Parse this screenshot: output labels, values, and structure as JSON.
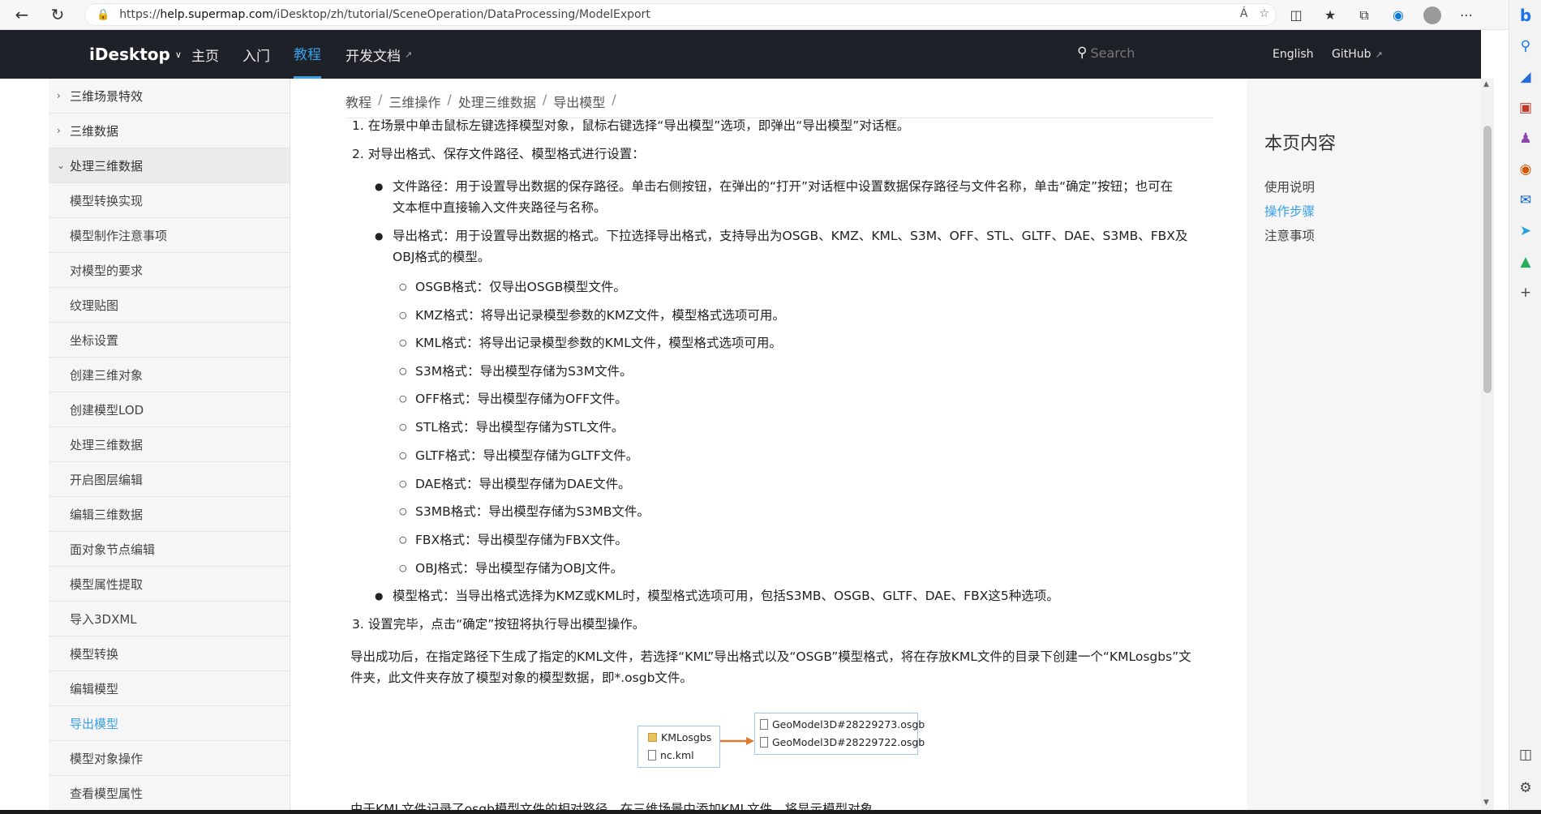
{
  "browser": {
    "url_prefix": "https://",
    "url_host": "help.supermap.com",
    "url_path": "/iDesktop/zh/tutorial/SceneOperation/DataProcessing/ModelExport",
    "read_aloud": "Á",
    "icons": [
      "back-icon",
      "refresh-icon",
      "lock-icon",
      "read-aloud-icon",
      "favorite-add-icon",
      "split-screen-icon",
      "favorites-icon",
      "collections-icon",
      "browser-essentials-icon",
      "profile-avatar",
      "more-icon"
    ]
  },
  "edge_sidebar": {
    "icons": [
      "bing-copilot-icon",
      "search-icon",
      "shopping-icon",
      "tools-icon",
      "games-icon",
      "office-icon",
      "outlook-icon",
      "send-icon",
      "tree-icon",
      "add-icon",
      "sidebar-toggle-icon",
      "settings-icon"
    ]
  },
  "header": {
    "brand": "iDesktop",
    "nav": [
      "主页",
      "入门",
      "教程",
      "开发文档"
    ],
    "active_nav": "教程",
    "search_placeholder": "Search",
    "english": "English",
    "github": "GitHub"
  },
  "sidebar": {
    "top_items": [
      "三维场景特效",
      "三维数据"
    ],
    "open_item": "处理三维数据",
    "sub_items": [
      "模型转换实现",
      "模型制作注意事项",
      "对模型的要求",
      "纹理贴图",
      "坐标设置",
      "创建三维对象",
      "创建模型LOD",
      "处理三维数据",
      "开启图层编辑",
      "编辑三维数据",
      "面对象节点编辑",
      "模型属性提取",
      "导入3DXML",
      "模型转换",
      "编辑模型",
      "导出模型",
      "模型对象操作",
      "查看模型属性"
    ],
    "active_sub": "导出模型"
  },
  "breadcrumb": [
    "教程",
    "三维操作",
    "处理三维数据",
    "导出模型"
  ],
  "content": {
    "step1": "1. 在场景中单击鼠标左键选择模型对象，鼠标右键选择“导出模型”选项，即弹出“导出模型”对话框。",
    "step2": "2. 对导出格式、保存文件路径、模型格式进行设置：",
    "bullet_path_line1": "文件路径：用于设置导出数据的保存路径。单击右侧按钮，在弹出的“打开”对话框中设置数据保存路径与文件名称，单击“确定”按钮；也可在",
    "bullet_path_line2": "文本框中直接输入文件夹路径与名称。",
    "bullet_format_line1": "导出格式：用于设置导出数据的格式。下拉选择导出格式，支持导出为OSGB、KMZ、KML、S3M、OFF、STL、GLTF、DAE、S3MB、FBX及",
    "bullet_format_line2": "OBJ格式的模型。",
    "formats": [
      "OSGB格式：仅导出OSGB模型文件。",
      "KMZ格式：将导出记录模型参数的KMZ文件，模型格式选项可用。",
      "KML格式：将导出记录模型参数的KML文件，模型格式选项可用。",
      "S3M格式：导出模型存储为S3M文件。",
      "OFF格式：导出模型存储为OFF文件。",
      "STL格式：导出模型存储为STL文件。",
      "GLTF格式：导出模型存储为GLTF文件。",
      "DAE格式：导出模型存储为DAE文件。",
      "S3MB格式：导出模型存储为S3MB文件。",
      "FBX格式：导出模型存储为FBX文件。",
      "OBJ格式：导出模型存储为OBJ文件。"
    ],
    "bullet_model": "模型格式：当导出格式选择为KMZ或KML时，模型格式选项可用，包括S3MB、OSGB、GLTF、DAE、FBX这5种选项。",
    "step3": "3. 设置完毕，点击“确定”按钮将执行导出模型操作。",
    "result_line1": "导出成功后，在指定路径下生成了指定的KML文件，若选择“KML”导出格式以及“OSGB”模型格式，将在存放KML文件的目录下创建一个“KMLosgbs”文",
    "result_line2": "件夹，此文件夹存放了模型对象的模型数据，即*.osgb文件。",
    "cutoff_line": "由于KML文件记录了osgb模型文件的相对路径，在三维场景中添加KML文件，将显示模型对象。"
  },
  "figure": {
    "folder": "KMLosgbs",
    "kml_file": "nc.kml",
    "osgb_files": [
      "GeoModel3D#28229273.osgb",
      "GeoModel3D#28229722.osgb"
    ],
    "arrow_color": "#e07a2e"
  },
  "toc": {
    "title": "本页内容",
    "items": [
      "使用说明",
      "操作步骤",
      "注意事项"
    ],
    "active": "操作步骤"
  },
  "colors": {
    "header_bg": "#1e2127",
    "accent": "#3aa0e8",
    "sidebar_bg": "#f6f6f6"
  }
}
